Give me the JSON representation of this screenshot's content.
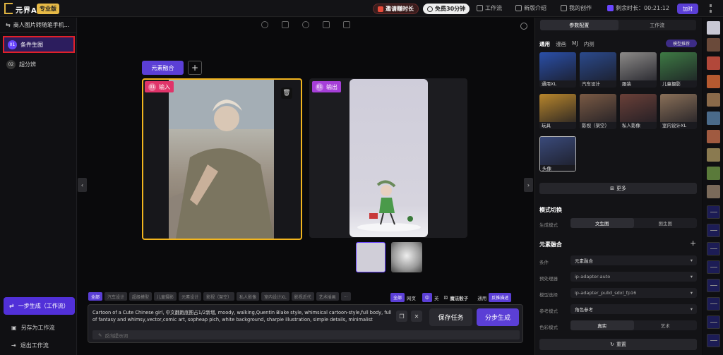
{
  "topbar": {
    "logo_text": "元界AI",
    "pro_badge": "专业版",
    "invite_pill": "邀请赚时长",
    "free_pill": "免费30分钟",
    "workflow": "工作流",
    "new_features": "新版介绍",
    "my_works": "我的创作",
    "remaining": "剩余时长：00:21:12",
    "recharge": "加时"
  },
  "left": {
    "project_title": "商人图片转随笔手机...",
    "steps": [
      {
        "num": "01",
        "label": "条件生图"
      },
      {
        "num": "02",
        "label": "超分辨"
      }
    ],
    "one_step": "一步生成（工作流）",
    "save_as_workflow": "另存为工作流",
    "exit_workflow": "退出工作流"
  },
  "center": {
    "element_fusion": "元素融合",
    "add": "+",
    "input_tag_num": "01",
    "input_tag": "输入",
    "output_tag_num": "01",
    "output_tag": "输出",
    "chips": [
      "全部",
      "汽车设计",
      "超级模型",
      "儿童摄影",
      "元素设计",
      "影视（架空）",
      "私人影像",
      "室内设计XL",
      "影视近代",
      "艺术插画",
      "…"
    ],
    "right_tools": {
      "all": "全部",
      "quick": "网页",
      "zh": "中",
      "en": "英",
      "magic": "魔法骰子",
      "general": "通用",
      "reverse": "反推描述"
    },
    "prompt": "Cartoon of a Cute Chinese girl, 中文翻跑底图占1/2新增, moody, walking,Quentin Blake style, whimsical cartoon-style,full body, full of fantasy and whimsy,vector,comic art, sopheap pich, white background, sharpie illustration, simple details, minimalist",
    "negative_placeholder": "反向提示词",
    "save_task": "保存任务",
    "generate": "分步生成"
  },
  "right": {
    "tabs": [
      "参数配置",
      "工作流"
    ],
    "categories": [
      "通用",
      "漫画",
      "MJ",
      "内测"
    ],
    "model_recommend": "模型推荐",
    "models": [
      {
        "label": "通用XL",
        "color": "#2a4fa8"
      },
      {
        "label": "汽车设计",
        "color": "#2b4a8c"
      },
      {
        "label": "服装",
        "color": "#8c8a88"
      },
      {
        "label": "儿童摄影",
        "color": "#3e7a44"
      },
      {
        "label": "玩具",
        "color": "#b8862c"
      },
      {
        "label": "影视（架空）",
        "color": "#7a5a44"
      },
      {
        "label": "私人影像",
        "color": "#6a4038"
      },
      {
        "label": "室内设计XL",
        "color": "#8a7058"
      },
      {
        "label": "头像",
        "color": "#3a4a7a"
      }
    ],
    "more": "更多",
    "style_switch": "模式切换",
    "gen_mode_label": "生成模式",
    "gen_modes": [
      "文生图",
      "图生图"
    ],
    "element_fusion": "元素融合",
    "condition_label": "条件",
    "condition_value": "元素融合",
    "preprocessor_label": "预处理器",
    "preprocessor_value": "ip-adapter-auto",
    "model_label": "模型选择",
    "model_value": "ip-adapter_pulid_sdxl_fp16",
    "ref_mode_label": "参考模式",
    "ref_mode_value": "角色参考",
    "color_mode_label": "色彩模式",
    "color_modes": [
      "真实",
      "艺术"
    ],
    "reset": "重置"
  },
  "strip_colors": [
    "#c8c8d4",
    "#6a4a3a",
    "#b2483a",
    "#b65a30",
    "#8a6a4a",
    "#4a6a8a",
    "#a05a40",
    "#8a7a50",
    "#5a7a3a",
    "#7a6a5a"
  ]
}
